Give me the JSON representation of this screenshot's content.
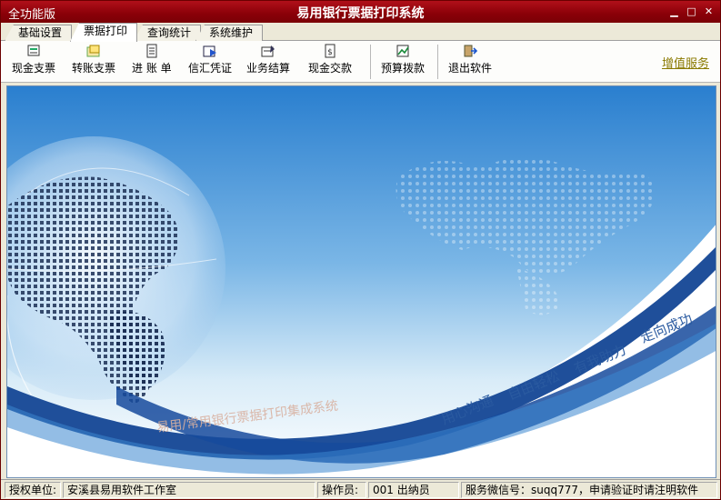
{
  "window": {
    "mode_label": "全功能版",
    "title": "易用银行票据打印系统"
  },
  "tabs": [
    {
      "label": "基础设置"
    },
    {
      "label": "票据打印"
    },
    {
      "label": "查询统计"
    },
    {
      "label": "系统维护"
    }
  ],
  "toolbar": {
    "items": [
      {
        "label": "现金支票",
        "icon": "cheque-icon"
      },
      {
        "label": "转账支票",
        "icon": "transfer-icon"
      },
      {
        "label": "进 账 单",
        "icon": "deposit-slip-icon"
      },
      {
        "label": "信汇凭证",
        "icon": "remittance-icon"
      },
      {
        "label": "业务结算",
        "icon": "settlement-icon"
      },
      {
        "label": "现金交款",
        "icon": "cash-payment-icon"
      },
      {
        "label": "预算拨款",
        "icon": "budget-icon"
      },
      {
        "label": "退出软件",
        "icon": "exit-icon"
      }
    ],
    "value_added": "增值服务"
  },
  "banner": {
    "slogan_1": "用心沟通",
    "slogan_2": "自由轻松",
    "slogan_3": "有我助力",
    "slogan_4": "走向成功",
    "caption": "易用/常用银行票据打印集成系统"
  },
  "statusbar": {
    "auth_label": "授权单位:",
    "auth_value": "安溪县易用软件工作室",
    "operator_label": "操作员:",
    "operator_value": "001 出纳员",
    "service": "服务微信号：suqq777，申请验证时请注明软件"
  },
  "colors": {
    "titlebar": "#8a0008",
    "banner_blue": "#1a5fb0",
    "link": "#8a7a00"
  }
}
